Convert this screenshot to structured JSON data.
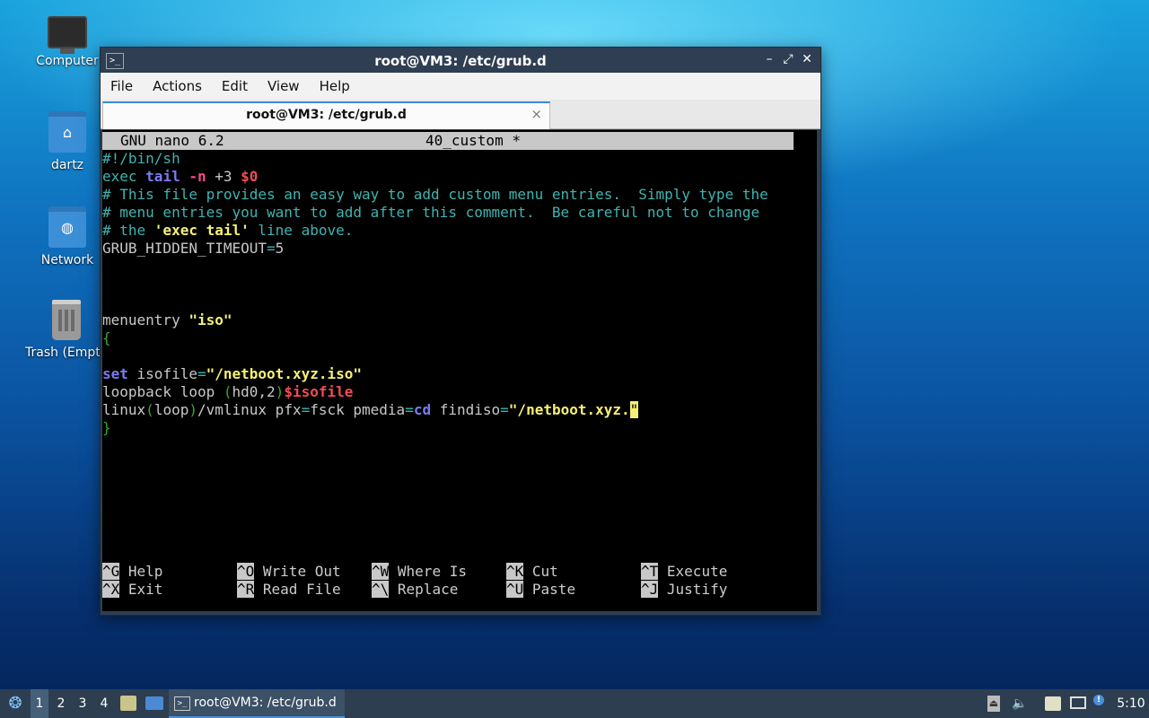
{
  "desktop": {
    "icons": [
      {
        "label": "Computer"
      },
      {
        "label": "dartz"
      },
      {
        "label": "Network"
      },
      {
        "label": "Trash (Empt"
      }
    ]
  },
  "window": {
    "title": "root@VM3: /etc/grub.d",
    "min_glyph": "–",
    "max_glyph": "⤢",
    "close_glyph": "✕",
    "term_glyph": ">_"
  },
  "menubar": {
    "file": "File",
    "actions": "Actions",
    "edit": "Edit",
    "view": "View",
    "help": "Help"
  },
  "tab": {
    "label": "root@VM3: /etc/grub.d",
    "close": "×"
  },
  "nano": {
    "version": "GNU nano 6.2",
    "filename": "40_custom *",
    "lines": {
      "l1": "#!/bin/sh",
      "l2_a": "exec ",
      "l2_b": "tail",
      "l2_c": " ",
      "l2_d": "-n",
      "l2_e": " +3 ",
      "l2_f": "$0",
      "l3": "# This file provides an easy way to add custom menu entries.  Simply type the",
      "l4": "# menu entries you want to add after this comment.  Be careful not to change",
      "l5_a": "# the ",
      "l5_b": "'exec tail'",
      "l5_c": " line above.",
      "l6_a": "GRUB_HIDDEN_TIMEOUT",
      "l6_b": "=",
      "l6_c": "5",
      "l10_a": "menuentry ",
      "l10_b": "\"iso\"",
      "l11": "{",
      "l13_a": "set",
      "l13_b": " isofile",
      "l13_c": "=",
      "l13_d": "\"/netboot.xyz.iso\"",
      "l14_a": "loopback loop ",
      "l14_b": "(",
      "l14_c": "hd0,2",
      "l14_d": ")",
      "l14_e": "$isofile",
      "l15_a": "linux",
      "l15_b": "(",
      "l15_c": "loop",
      "l15_d": ")",
      "l15_e": "/vmlinux pfx",
      "l15_f": "=",
      "l15_g": "fsck pmedia",
      "l15_h": "=",
      "l15_i": "cd",
      "l15_j": " findiso",
      "l15_k": "=",
      "l15_l": "\"/netboot.xyz.",
      "l15_m": "\"",
      "l16": "}"
    },
    "shortcuts": [
      {
        "key": "^G",
        "label": "Help"
      },
      {
        "key": "^O",
        "label": "Write Out"
      },
      {
        "key": "^W",
        "label": "Where Is"
      },
      {
        "key": "^K",
        "label": "Cut"
      },
      {
        "key": "^T",
        "label": "Execute"
      },
      {
        "key": "^X",
        "label": "Exit"
      },
      {
        "key": "^R",
        "label": "Read File"
      },
      {
        "key": "^\\",
        "label": "Replace"
      },
      {
        "key": "^U",
        "label": "Paste"
      },
      {
        "key": "^J",
        "label": "Justify"
      }
    ]
  },
  "taskbar": {
    "workspaces": [
      "1",
      "2",
      "3",
      "4"
    ],
    "task_label": "root@VM3: /etc/grub.d",
    "clock": "5:10",
    "menu_glyph": "❂",
    "volume_glyph": "🔈",
    "eject_glyph": "⏏",
    "notify_glyph": "!"
  },
  "colors": {
    "terminal_bg": "#000000",
    "comment": "#3fb4b0",
    "keyword": "#7b7bf0",
    "string": "#f5f075",
    "variable": "#f04b56",
    "taskbar_bg": "#2c3e50",
    "titlebar_bg": "#2f3e52"
  }
}
